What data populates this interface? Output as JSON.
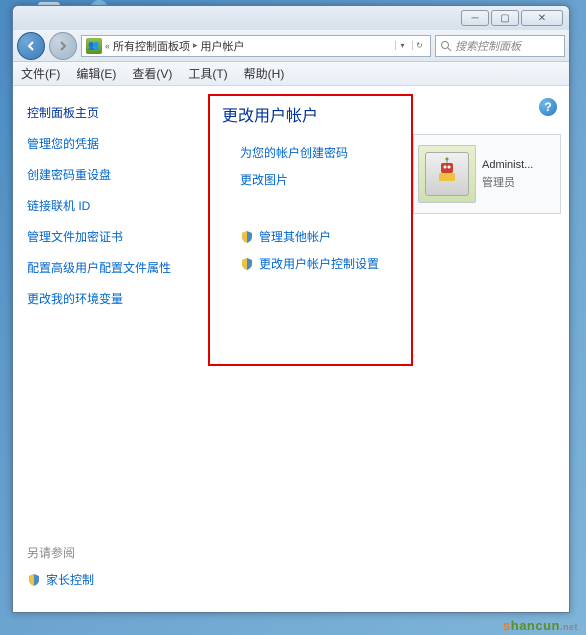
{
  "breadcrumb": {
    "sep1": "«",
    "item1": "所有控制面板项",
    "item2": "用户帐户"
  },
  "search": {
    "placeholder": "搜索控制面板"
  },
  "menu": {
    "file": "文件(F)",
    "edit": "编辑(E)",
    "view": "查看(V)",
    "tools": "工具(T)",
    "help": "帮助(H)"
  },
  "sidebar": {
    "title": "控制面板主页",
    "links": [
      "管理您的凭据",
      "创建密码重设盘",
      "链接联机 ID",
      "管理文件加密证书",
      "配置高级用户配置文件属性",
      "更改我的环境变量"
    ]
  },
  "main": {
    "title": "更改用户帐户",
    "link1": "为您的帐户创建密码",
    "link2": "更改图片",
    "link3": "管理其他帐户",
    "link4": "更改用户帐户控制设置"
  },
  "user": {
    "name": "Administ...",
    "role": "管理员"
  },
  "seeAlso": {
    "title": "另请参阅",
    "link": "家长控制"
  },
  "watermark": {
    "s": "s",
    "rest": "hancun",
    "dot": ".net"
  }
}
